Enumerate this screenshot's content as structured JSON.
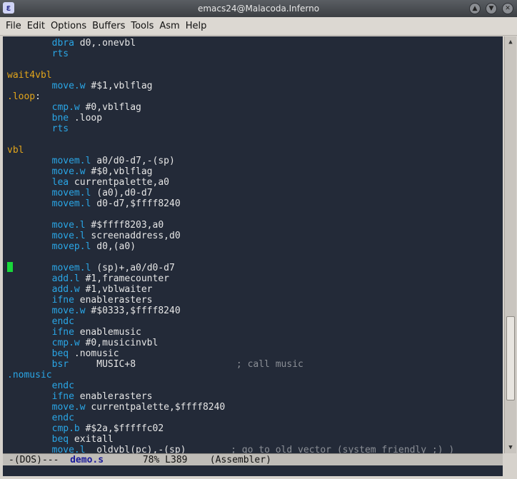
{
  "window": {
    "title": "emacs24@Malacoda.Inferno",
    "icon": "emacs-icon",
    "controls": [
      "shade-up-icon",
      "minimize-icon",
      "maximize-icon",
      "close-icon"
    ]
  },
  "menubar": [
    "File",
    "Edit",
    "Options",
    "Buffers",
    "Tools",
    "Asm",
    "Help"
  ],
  "code_lines": [
    {
      "indent": "        ",
      "kw": "dbra",
      "rest": " d0,.onevbl"
    },
    {
      "indent": "        ",
      "kw": "rts",
      "rest": ""
    },
    {
      "blank": true
    },
    {
      "label": "wait4vbl"
    },
    {
      "indent": "        ",
      "kw": "move.w",
      "rest": " #$1,vblflag"
    },
    {
      "label": ".loop",
      "suffix": ":"
    },
    {
      "indent": "        ",
      "kw": "cmp.w",
      "rest": " #0,vblflag"
    },
    {
      "indent": "        ",
      "kw": "bne",
      "rest": " .loop"
    },
    {
      "indent": "        ",
      "kw": "rts",
      "rest": ""
    },
    {
      "blank": true
    },
    {
      "label": "vbl"
    },
    {
      "indent": "        ",
      "kw": "movem.l",
      "rest": " a0/d0-d7,-(sp)"
    },
    {
      "indent": "        ",
      "kw": "move.w",
      "rest": " #$0,vblflag"
    },
    {
      "indent": "        ",
      "kw": "lea",
      "rest": " currentpalette,a0"
    },
    {
      "indent": "        ",
      "kw": "movem.l",
      "rest": " (a0),d0-d7"
    },
    {
      "indent": "        ",
      "kw": "movem.l",
      "rest": " d0-d7,$ffff8240"
    },
    {
      "blank": true
    },
    {
      "indent": "        ",
      "kw": "move.l",
      "rest": " #$ffff8203,a0"
    },
    {
      "indent": "        ",
      "kw": "move.l",
      "rest": " screenaddress,d0"
    },
    {
      "indent": "        ",
      "kw": "movep.l",
      "rest": " d0,(a0)"
    },
    {
      "blank": true
    },
    {
      "indent": "        ",
      "kw": "movem.l",
      "rest": " (sp)+,a0/d0-d7"
    },
    {
      "indent": "        ",
      "kw": "add.l",
      "rest": " #1,framecounter"
    },
    {
      "indent": "        ",
      "kw": "add.w",
      "rest": " #1,vblwaiter"
    },
    {
      "indent": "        ",
      "kw": "ifne",
      "rest": " enablerasters"
    },
    {
      "indent": "        ",
      "kw": "move.w",
      "rest": " #$0333,$ffff8240"
    },
    {
      "indent": "        ",
      "kw": "endc",
      "rest": ""
    },
    {
      "indent": "        ",
      "kw": "ifne",
      "rest": " enablemusic"
    },
    {
      "indent": "        ",
      "kw": "cmp.w",
      "rest": " #0,musicinvbl"
    },
    {
      "indent": "        ",
      "kw": "beq",
      "rest": " .nomusic"
    },
    {
      "indent": "        ",
      "kw": "bsr",
      "rest": "     MUSIC+8",
      "comment": "; call music",
      "comment_pad": "                  "
    },
    {
      "label": ".nomusic",
      "label_color": "blue"
    },
    {
      "indent": "        ",
      "kw": "endc",
      "rest": ""
    },
    {
      "indent": "        ",
      "kw": "ifne",
      "rest": " enablerasters"
    },
    {
      "indent": "        ",
      "kw": "move.w",
      "rest": " currentpalette,$ffff8240"
    },
    {
      "indent": "        ",
      "kw": "endc",
      "rest": ""
    },
    {
      "indent": "        ",
      "kw": "cmp.b",
      "rest": " #$2a,$fffffc02"
    },
    {
      "indent": "        ",
      "kw": "beq",
      "rest": " exitall"
    },
    {
      "indent": "        ",
      "kw": "move.l",
      "rest": "  oldvbl(pc),-(sp)",
      "comment": "; go to old vector (system friendly ;) )",
      "comment_pad": "        "
    }
  ],
  "modeline": {
    "prefix": "-(DOS)---  ",
    "buffer": "demo.s",
    "position": "78%",
    "line": "L389",
    "mode": "(Assembler)"
  },
  "colors": {
    "background": "#232a38",
    "keyword": "#2aa6e6",
    "label": "#e2a51b",
    "comment": "#8b8f96",
    "cursor": "#18d83a"
  }
}
